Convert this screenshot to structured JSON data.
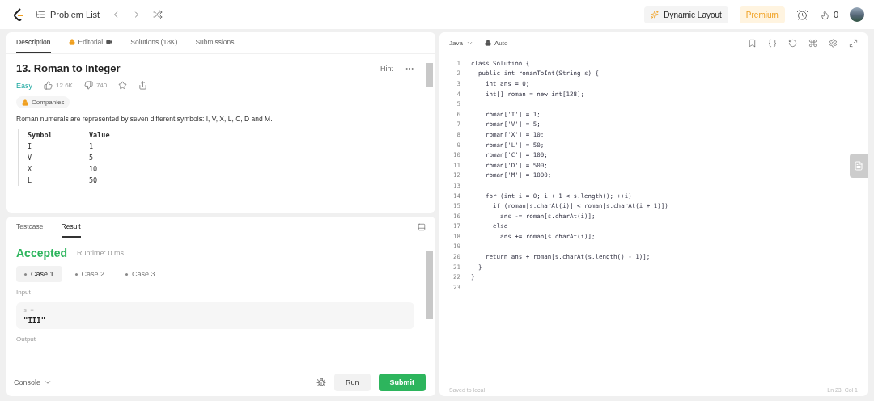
{
  "nav": {
    "problem_list": "Problem List",
    "dynamic_layout": "Dynamic Layout",
    "premium": "Premium",
    "streak": "0"
  },
  "description": {
    "tabs": [
      {
        "label": "Description",
        "selected": true,
        "locked": false
      },
      {
        "label": "Editorial",
        "selected": false,
        "locked": true
      },
      {
        "label": "Solutions (18K)",
        "selected": false,
        "locked": false
      },
      {
        "label": "Submissions",
        "selected": false,
        "locked": false
      }
    ],
    "title": "13. Roman to Integer",
    "hint": "Hint",
    "difficulty": "Easy",
    "likes": "12.6K",
    "dislikes": "740",
    "companies": "Companies",
    "paragraph": "Roman numerals are represented by seven different symbols: I, V, X, L, C, D and M.",
    "table": {
      "columns": [
        "Symbol",
        "Value"
      ],
      "rows": [
        [
          "I",
          "1"
        ],
        [
          "V",
          "5"
        ],
        [
          "X",
          "10"
        ],
        [
          "L",
          "50"
        ]
      ]
    }
  },
  "console": {
    "tabs": [
      {
        "label": "Testcase",
        "selected": false
      },
      {
        "label": "Result",
        "selected": true
      }
    ],
    "status": "Accepted",
    "runtime": "Runtime: 0 ms",
    "cases": [
      {
        "label": "Case 1",
        "selected": true
      },
      {
        "label": "Case 2",
        "selected": false
      },
      {
        "label": "Case 3",
        "selected": false
      }
    ],
    "input_label": "Input",
    "input_name": "s =",
    "input_value": "\"III\"",
    "output_label": "Output",
    "console_label": "Console",
    "run": "Run",
    "submit": "Submit"
  },
  "editor": {
    "language": "Java",
    "mode": "Auto",
    "saved": "Saved to local",
    "cursor": "Ln 23, Col 1",
    "lines": [
      {
        "number": "1",
        "text": "class Solution {"
      },
      {
        "number": "2",
        "text": "  public int romanToInt(String s) {"
      },
      {
        "number": "3",
        "text": "    int ans = 0;"
      },
      {
        "number": "4",
        "text": "    int[] roman = new int[128];"
      },
      {
        "number": "5"
      },
      {
        "number": "6",
        "text": "    roman['I'] = 1;"
      },
      {
        "number": "7",
        "text": "    roman['V'] = 5;"
      },
      {
        "number": "8",
        "text": "    roman['X'] = 10;"
      },
      {
        "number": "9",
        "text": "    roman['L'] = 50;"
      },
      {
        "number": "10",
        "text": "    roman['C'] = 100;"
      },
      {
        "number": "11",
        "text": "    roman['D'] = 500;"
      },
      {
        "number": "12",
        "text": "    roman['M'] = 1000;"
      },
      {
        "number": "13"
      },
      {
        "number": "14",
        "text": "    for (int i = 0; i + 1 < s.length(); ++i)"
      },
      {
        "number": "15",
        "text": "      if (roman[s.charAt(i)] < roman[s.charAt(i + 1)])"
      },
      {
        "number": "16",
        "text": "        ans -= roman[s.charAt(i)];"
      },
      {
        "number": "17",
        "text": "      else"
      },
      {
        "number": "18",
        "text": "        ans += roman[s.charAt(i)];"
      },
      {
        "number": "19"
      },
      {
        "number": "20",
        "text": "    return ans + roman[s.charAt(s.length() - 1)];"
      },
      {
        "number": "21",
        "text": "  }"
      },
      {
        "number": "22",
        "text": "}"
      },
      {
        "number": "23"
      }
    ]
  }
}
